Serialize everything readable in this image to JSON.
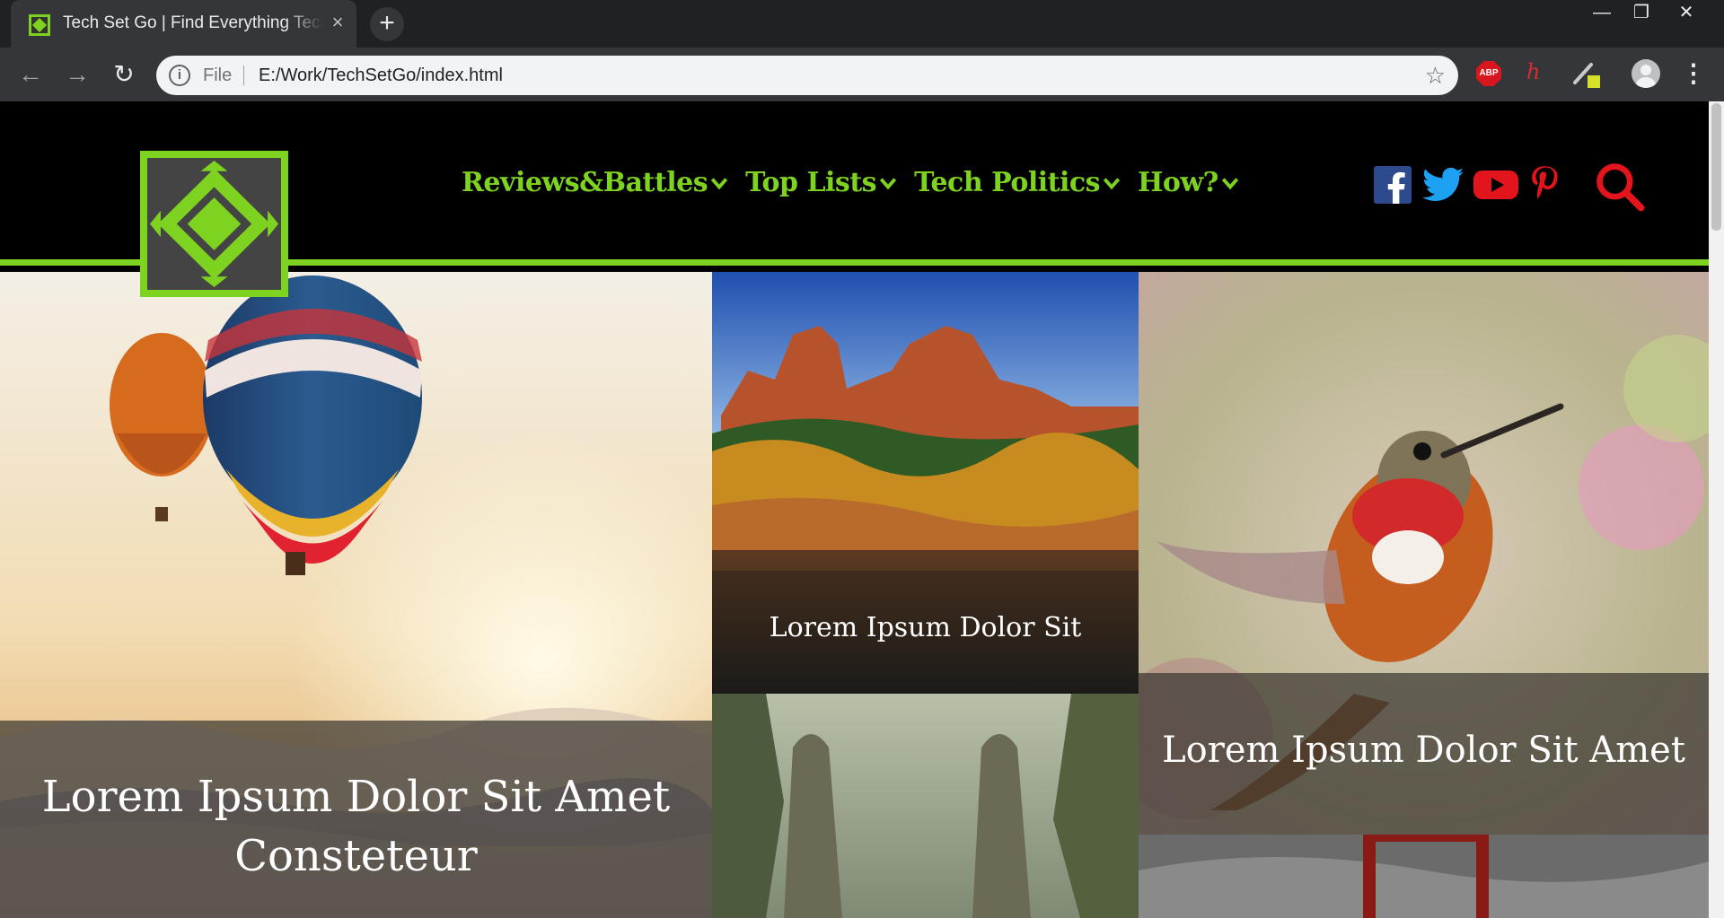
{
  "browser": {
    "tab_title": "Tech Set Go | Find Everything Tech",
    "tab_close": "×",
    "new_tab": "+",
    "window_controls": {
      "minimize": "—",
      "restore": "❐",
      "close": "✕"
    },
    "back": "←",
    "forward": "→",
    "reload": "↻",
    "scheme_label": "File",
    "url": "E:/Work/TechSetGo/index.html",
    "bookmark_star": "☆",
    "ext_abp": "ABP",
    "ext_h": "h",
    "menu": "⋮"
  },
  "site": {
    "nav": [
      {
        "label": "Reviews&Battles"
      },
      {
        "label": "Top Lists"
      },
      {
        "label": "Tech Politics"
      },
      {
        "label": "How?"
      }
    ],
    "social_icons": [
      "facebook-icon",
      "twitter-icon",
      "youtube-icon",
      "pinterest-icon"
    ],
    "brand_green": "#7ed321",
    "accent_red": "#e3141c"
  },
  "tiles": {
    "balloons": {
      "caption": "Lorem Ipsum Dolor Sit Amet Consteteur"
    },
    "canyon": {
      "caption": "Lorem Ipsum Dolor Sit"
    },
    "hummingbird": {
      "caption": "Lorem Ipsum Dolor Sit Amet"
    }
  }
}
